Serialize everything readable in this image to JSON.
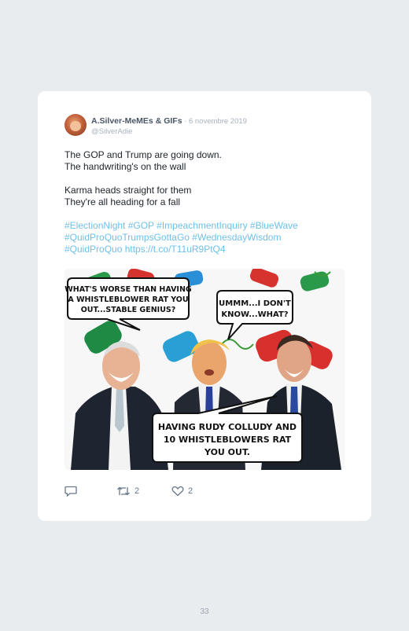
{
  "tweet": {
    "author_name": "A.Silver-MeMEs & GIFs",
    "date": " · 6 novembre 2019",
    "handle": "@SilverAdie",
    "lines": [
      "The GOP and Trump are going down.",
      "The handwriting's on the wall",
      "Karma heads straight for them",
      "They're all heading for a fall"
    ],
    "tags_line1": "#ElectionNight #GOP #ImpeachmentInquiry #BlueWave",
    "tags_line2": "#QuidProQuoTrumpsGottaGo #WednesdayWisdom",
    "tags_line3": "#QuidProQuo https://t.co/T11uR9PtQ4"
  },
  "meme": {
    "bubble_left": [
      "WHAT'S WORSE THAN HAVING",
      "A WHISTLEBLOWER RAT YOU",
      "OUT...STABLE GENIUS?"
    ],
    "bubble_right": [
      "UMMM...I DON'T",
      "KNOW...WHAT?"
    ],
    "bubble_bottom": [
      "HAVING RUDY COLLUDY AND",
      "10 WHISTLEBLOWERS RAT",
      "YOU OUT."
    ]
  },
  "actions": {
    "reply_icon": "reply-icon",
    "retweet_icon": "retweet-icon",
    "retweet_count": "2",
    "like_icon": "heart-icon",
    "like_count": "2"
  },
  "page": {
    "number": "33"
  }
}
